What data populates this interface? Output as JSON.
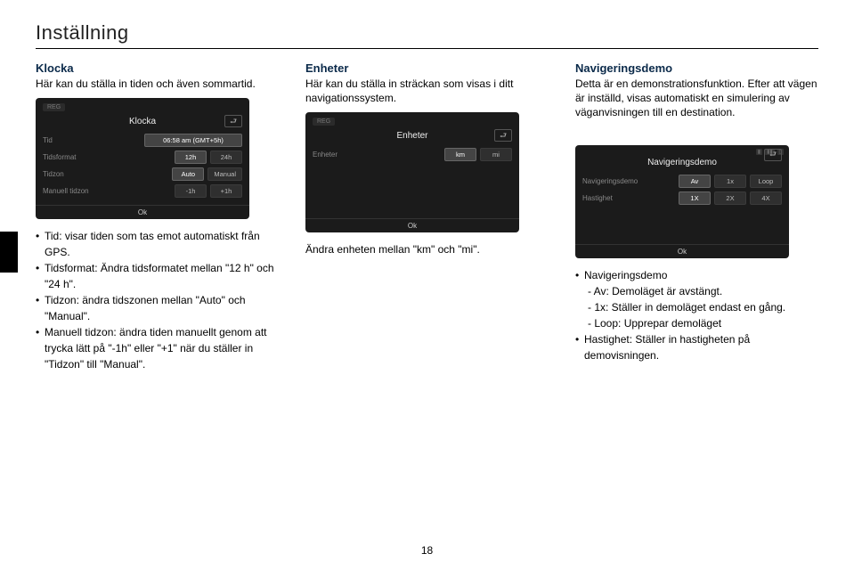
{
  "page": {
    "title": "Inställning",
    "number": "18"
  },
  "col1": {
    "heading": "Klocka",
    "sub": "Här kan du ställa in tiden och även sommartid.",
    "device": {
      "tag": "REG",
      "title": "Klocka",
      "back": "⮐",
      "rows": [
        {
          "label": "Tid",
          "vals": [
            "06:58 am (GMT+5h)"
          ],
          "sel": [
            true
          ]
        },
        {
          "label": "Tidsformat",
          "vals": [
            "12h",
            "24h"
          ],
          "sel": [
            true,
            false
          ]
        },
        {
          "label": "Tidzon",
          "vals": [
            "Auto",
            "Manual"
          ],
          "sel": [
            true,
            false
          ]
        },
        {
          "label": "Manuell tidzon",
          "vals": [
            "-1h",
            "+1h"
          ],
          "sel": [
            false,
            false
          ]
        }
      ],
      "ok": "Ok"
    },
    "bullets": [
      "Tid: visar tiden som tas emot automatiskt från GPS.",
      "Tidsformat: Ändra tidsformatet mellan \"12 h\" och \"24 h\".",
      "Tidzon: ändra tidszonen mellan \"Auto\" och \"Manual\".",
      "Manuell tidzon: ändra tiden manuellt genom att trycka lätt på \"-1h\" eller \"+1\" när du ställer in \"Tidzon\" till \"Manual\"."
    ]
  },
  "col2": {
    "heading": "Enheter",
    "sub": "Här kan du ställa in sträckan som visas i ditt navigationssystem.",
    "device": {
      "tag": "REG",
      "title": "Enheter",
      "back": "⮐",
      "rows": [
        {
          "label": "Enheter",
          "vals": [
            "km",
            "mi"
          ],
          "sel": [
            true,
            false
          ]
        }
      ],
      "ok": "Ok"
    },
    "line": "Ändra enheten mellan \"km\" och \"mi\"."
  },
  "col3": {
    "heading": "Navigeringsdemo",
    "sub": "Detta är en demonstrationsfunktion. Efter att vägen är inställd, visas automatiskt en simulering av väganvisningen till en destination.",
    "device": {
      "title": "Navigeringsdemo",
      "back": "⮐",
      "rows": [
        {
          "label": "Navigeringsdemo",
          "vals": [
            "Av",
            "1x",
            "Loop"
          ],
          "sel": [
            true,
            false,
            false
          ]
        },
        {
          "label": "Hastighet",
          "vals": [
            "1X",
            "2X",
            "4X"
          ],
          "sel": [
            true,
            false,
            false
          ]
        }
      ],
      "ok": "Ok"
    },
    "bullets_intro": "Navigeringsdemo",
    "subbullets": [
      "- Av: Demoläget är avstängt.",
      "- 1x: Ställer in demoläget endast en gång.",
      "- Loop: Upprepar demoläget"
    ],
    "bullet2": "Hastighet: Ställer in hastigheten på demovisningen."
  }
}
